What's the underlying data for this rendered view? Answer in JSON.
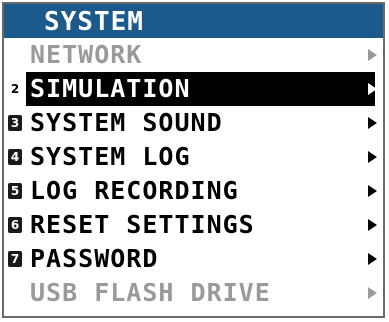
{
  "menu": {
    "title": "SYSTEM",
    "accent_color": "#1c5a8c",
    "items": [
      {
        "number": "",
        "label": "NETWORK",
        "icon": "chevron-right-icon",
        "state": "disabled"
      },
      {
        "number": "2",
        "label": "SIMULATION",
        "icon": "chevron-right-icon",
        "state": "selected"
      },
      {
        "number": "3",
        "label": "SYSTEM SOUND",
        "icon": "chevron-right-icon",
        "state": "enabled"
      },
      {
        "number": "4",
        "label": "SYSTEM LOG",
        "icon": "chevron-right-icon",
        "state": "enabled"
      },
      {
        "number": "5",
        "label": "LOG RECORDING",
        "icon": "chevron-right-icon",
        "state": "enabled"
      },
      {
        "number": "6",
        "label": "RESET SETTINGS",
        "icon": "chevron-right-icon",
        "state": "enabled"
      },
      {
        "number": "7",
        "label": "PASSWORD",
        "icon": "chevron-right-icon",
        "state": "enabled"
      },
      {
        "number": "",
        "label": "USB FLASH DRIVE",
        "icon": "chevron-right-icon",
        "state": "disabled"
      }
    ]
  }
}
